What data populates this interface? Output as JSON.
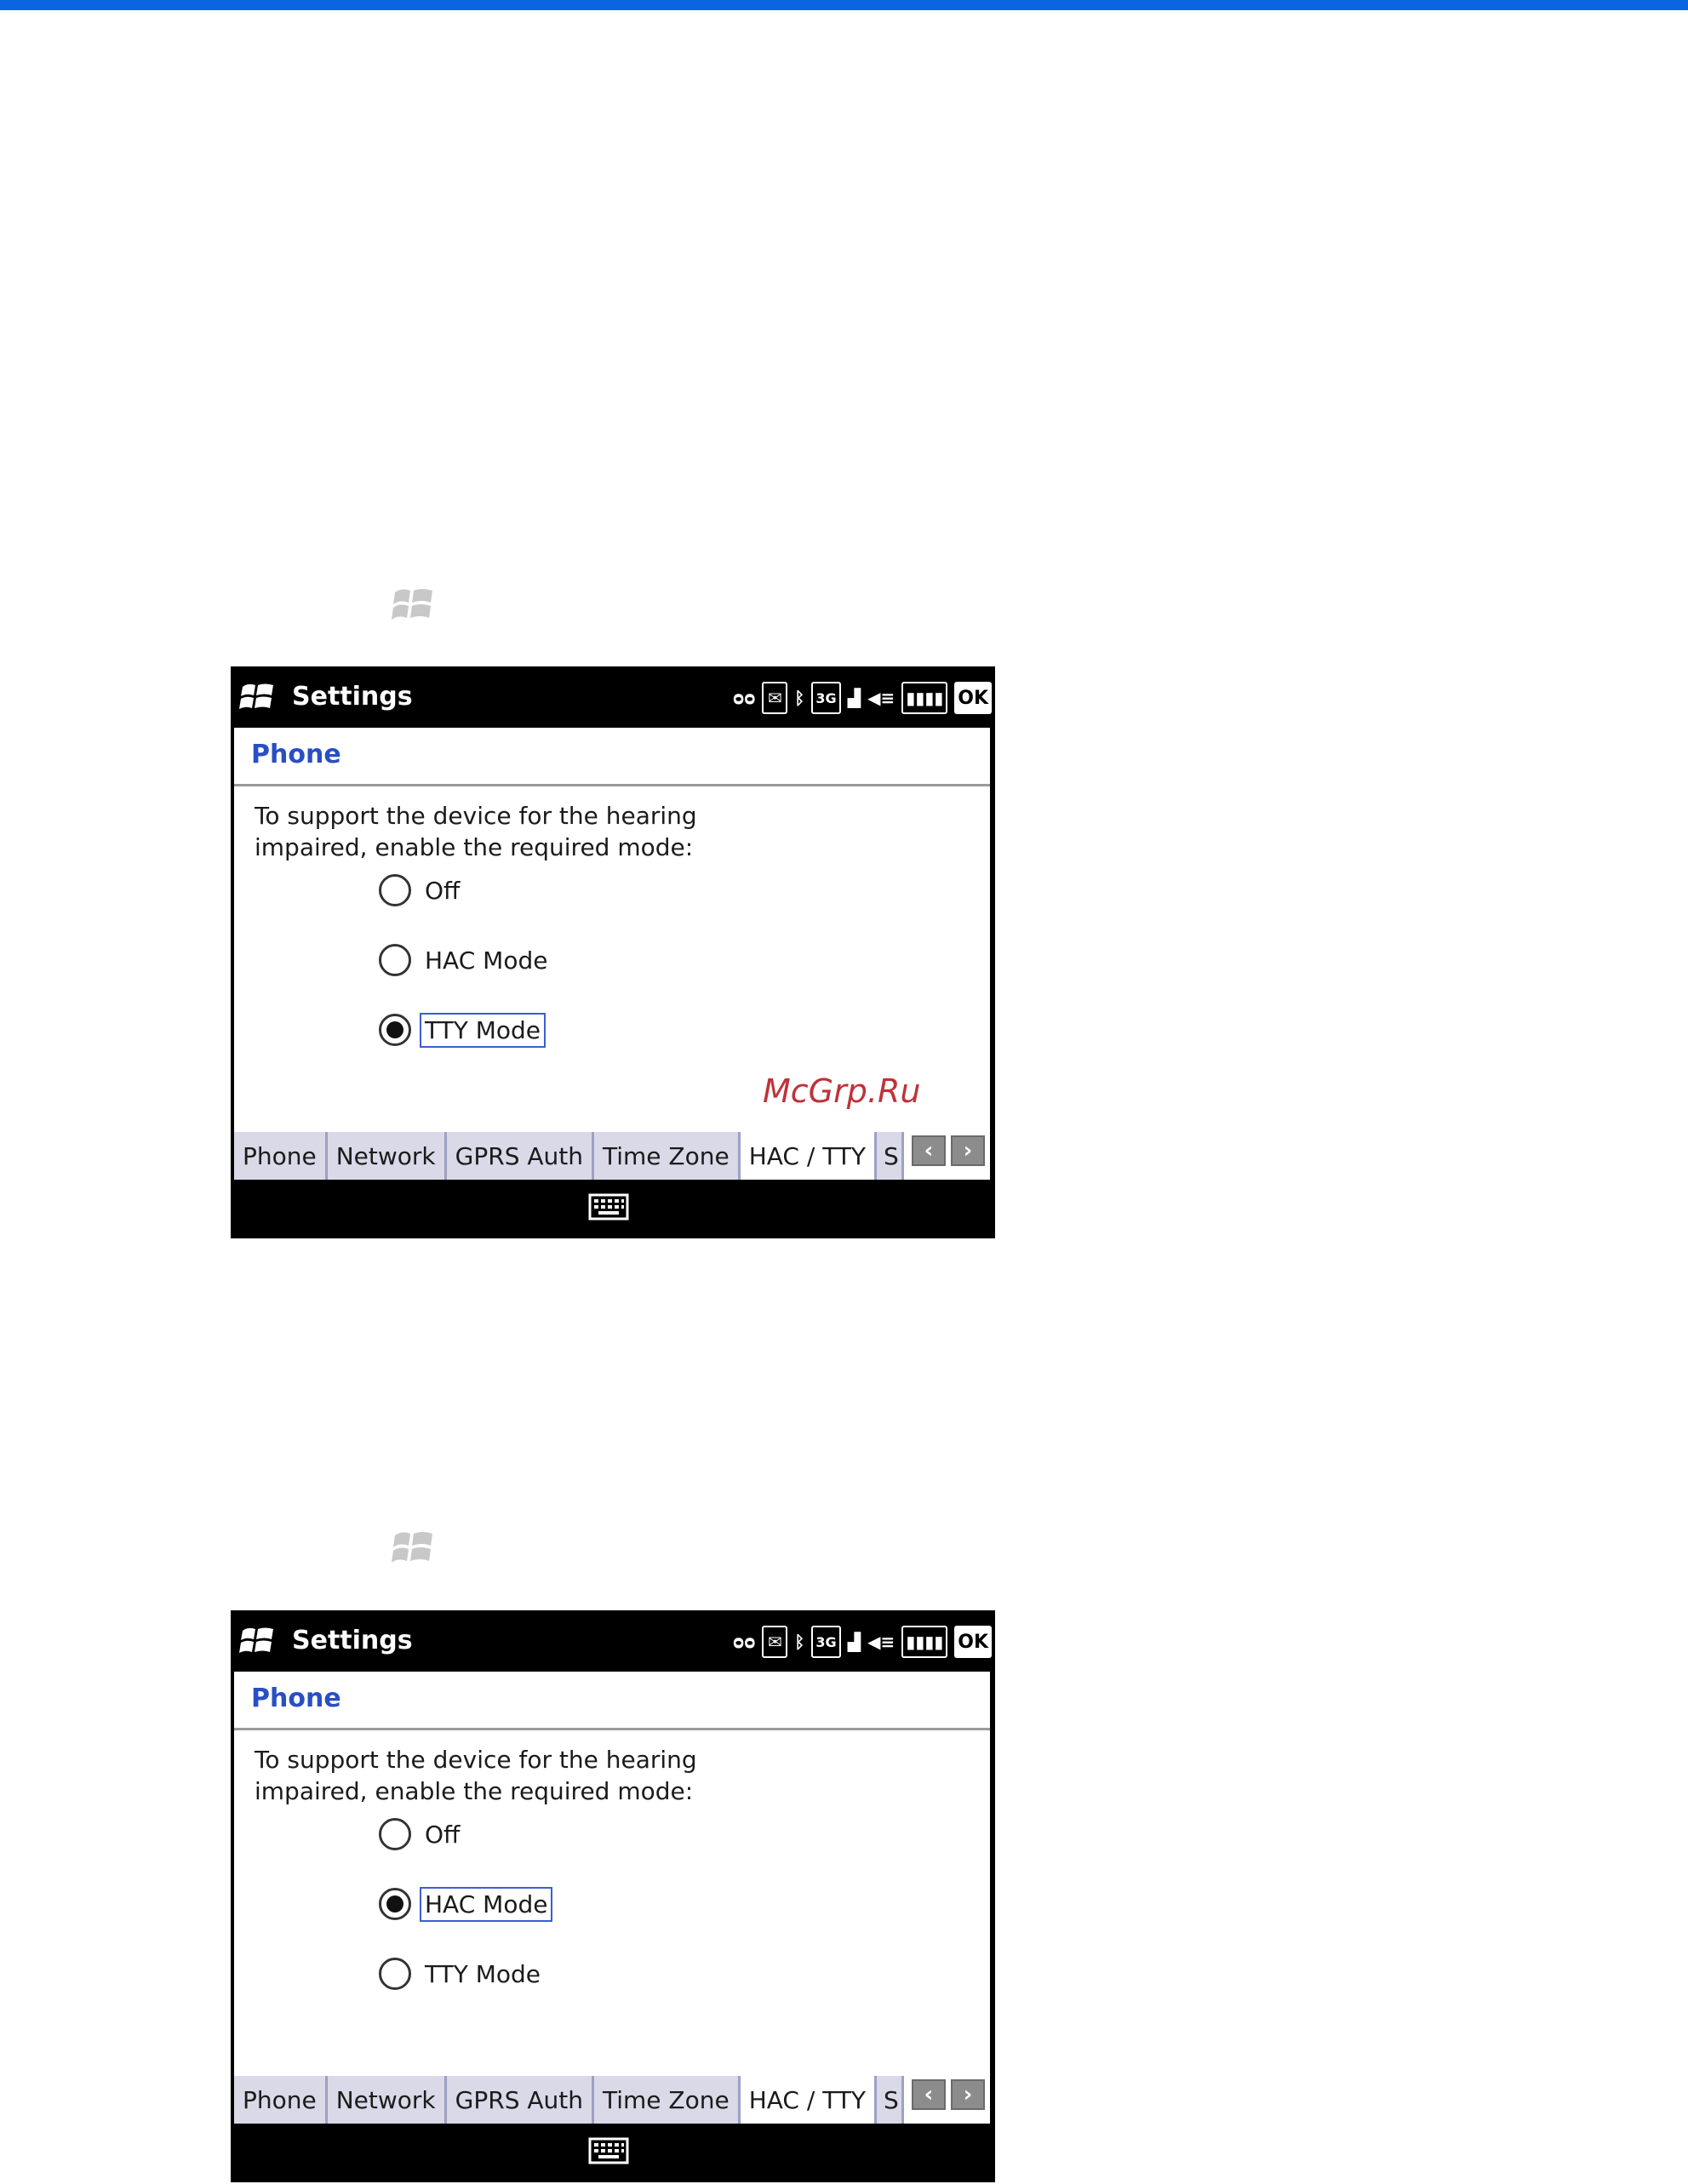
{
  "page": {
    "accent_color": "#0a66e0"
  },
  "screens": [
    {
      "title": "Settings",
      "status_icons": [
        "voicemail-icon",
        "message-icon",
        "bluetooth-icon",
        "3g-icon",
        "signal-icon",
        "speaker-icon",
        "battery-icon"
      ],
      "ok_label": "OK",
      "header": "Phone",
      "prompt": "To support the device for the hearing impaired, enable the required mode:",
      "options": [
        {
          "label": "Off",
          "selected": false
        },
        {
          "label": "HAC Mode",
          "selected": false
        },
        {
          "label": "TTY Mode",
          "selected": true
        }
      ],
      "tabs": [
        "Phone",
        "Network",
        "GPRS Auth",
        "Time Zone",
        "HAC / TTY",
        "S"
      ],
      "active_tab": "HAC / TTY"
    },
    {
      "title": "Settings",
      "status_icons": [
        "voicemail-icon",
        "message-icon",
        "bluetooth-icon",
        "3g-icon",
        "signal-icon",
        "speaker-icon",
        "battery-icon"
      ],
      "ok_label": "OK",
      "header": "Phone",
      "prompt": "To support the device for the hearing impaired, enable the required mode:",
      "options": [
        {
          "label": "Off",
          "selected": false
        },
        {
          "label": "HAC Mode",
          "selected": true
        },
        {
          "label": "TTY Mode",
          "selected": false
        }
      ],
      "tabs": [
        "Phone",
        "Network",
        "GPRS Auth",
        "Time Zone",
        "HAC / TTY",
        "S"
      ],
      "active_tab": "HAC / TTY"
    }
  ],
  "watermark": "McGrp.Ru"
}
